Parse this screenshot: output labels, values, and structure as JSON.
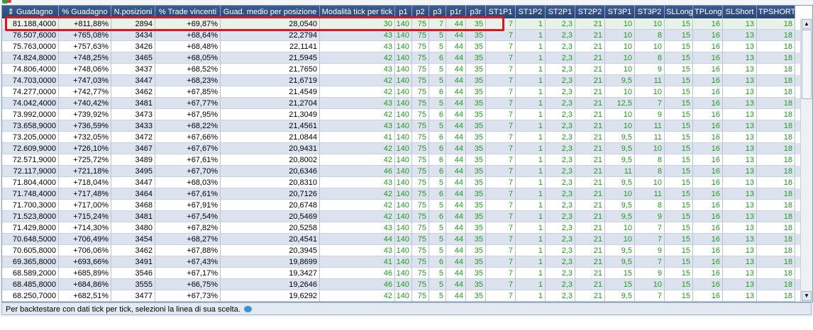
{
  "columns": [
    {
      "label": "Guadagno",
      "sort_icon": "sort-arrow-icon"
    },
    {
      "label": "% Guadagno"
    },
    {
      "label": "N.posizioni"
    },
    {
      "label": "% Trade vincenti"
    },
    {
      "label": "Guad. medio per posizione"
    },
    {
      "label": "Modalità tick per tick"
    },
    {
      "label": "p1"
    },
    {
      "label": "p2"
    },
    {
      "label": "p3"
    },
    {
      "label": "p1r"
    },
    {
      "label": "p3r"
    },
    {
      "label": "ST1P1"
    },
    {
      "label": "ST1P2"
    },
    {
      "label": "ST2P1"
    },
    {
      "label": "ST2P2"
    },
    {
      "label": "ST3P1"
    },
    {
      "label": "ST3P2"
    },
    {
      "label": "SLLong"
    },
    {
      "label": "TPLong"
    },
    {
      "label": "SLShort"
    },
    {
      "label": "TPSHORT"
    }
  ],
  "rows": [
    [
      "81.188,4000",
      "+811,88%",
      "2894",
      "+69,87%",
      "28,0540",
      "30",
      "140",
      "75",
      "7",
      "44",
      "35",
      "7",
      "1",
      "2,3",
      "21",
      "10",
      "10",
      "15",
      "16",
      "13",
      "18"
    ],
    [
      "76.507,6000",
      "+765,08%",
      "3434",
      "+68,64%",
      "22,2794",
      "43",
      "140",
      "75",
      "5",
      "44",
      "35",
      "7",
      "1",
      "2,3",
      "21",
      "10",
      "8",
      "15",
      "16",
      "13",
      "18"
    ],
    [
      "75.763,0000",
      "+757,63%",
      "3426",
      "+68,48%",
      "22,1141",
      "43",
      "140",
      "75",
      "5",
      "44",
      "35",
      "7",
      "1",
      "2,3",
      "21",
      "10",
      "10",
      "15",
      "16",
      "13",
      "18"
    ],
    [
      "74.824,8000",
      "+748,25%",
      "3465",
      "+68,05%",
      "21,5945",
      "42",
      "140",
      "75",
      "6",
      "44",
      "35",
      "7",
      "1",
      "2,3",
      "21",
      "10",
      "8",
      "15",
      "16",
      "13",
      "18"
    ],
    [
      "74.806,4000",
      "+748,06%",
      "3437",
      "+68,52%",
      "21,7650",
      "43",
      "140",
      "75",
      "5",
      "44",
      "35",
      "7",
      "1",
      "2,3",
      "21",
      "10",
      "9",
      "15",
      "16",
      "13",
      "18"
    ],
    [
      "74.703,0000",
      "+747,03%",
      "3447",
      "+68,23%",
      "21,6719",
      "42",
      "140",
      "75",
      "5",
      "44",
      "35",
      "7",
      "1",
      "2,3",
      "21",
      "9,5",
      "11",
      "15",
      "16",
      "13",
      "18"
    ],
    [
      "74.277,0000",
      "+742,77%",
      "3462",
      "+67,85%",
      "21,4549",
      "42",
      "140",
      "75",
      "6",
      "44",
      "35",
      "7",
      "1",
      "2,3",
      "21",
      "10",
      "10",
      "15",
      "16",
      "13",
      "18"
    ],
    [
      "74.042,4000",
      "+740,42%",
      "3481",
      "+67,77%",
      "21,2704",
      "43",
      "140",
      "75",
      "5",
      "44",
      "35",
      "7",
      "1",
      "2,3",
      "21",
      "12,5",
      "7",
      "15",
      "16",
      "13",
      "18"
    ],
    [
      "73.992,0000",
      "+739,92%",
      "3473",
      "+67,95%",
      "21,3049",
      "42",
      "140",
      "75",
      "6",
      "44",
      "35",
      "7",
      "1",
      "2,3",
      "21",
      "10",
      "9",
      "15",
      "16",
      "13",
      "18"
    ],
    [
      "73.658,9000",
      "+736,59%",
      "3433",
      "+68,22%",
      "21,4561",
      "43",
      "140",
      "75",
      "5",
      "44",
      "35",
      "7",
      "1",
      "2,3",
      "21",
      "10",
      "11",
      "15",
      "16",
      "13",
      "18"
    ],
    [
      "73.205,0000",
      "+732,05%",
      "3472",
      "+67,66%",
      "21,0844",
      "41",
      "140",
      "75",
      "6",
      "44",
      "35",
      "7",
      "1",
      "2,3",
      "21",
      "9,5",
      "11",
      "15",
      "16",
      "13",
      "18"
    ],
    [
      "72.609,9000",
      "+726,10%",
      "3467",
      "+67,67%",
      "20,9431",
      "42",
      "140",
      "75",
      "6",
      "44",
      "35",
      "7",
      "1",
      "2,3",
      "21",
      "9,5",
      "10",
      "15",
      "16",
      "13",
      "18"
    ],
    [
      "72.571,9000",
      "+725,72%",
      "3489",
      "+67,61%",
      "20,8002",
      "42",
      "140",
      "75",
      "6",
      "44",
      "35",
      "7",
      "1",
      "2,3",
      "21",
      "9,5",
      "8",
      "15",
      "16",
      "13",
      "18"
    ],
    [
      "72.117,9000",
      "+721,18%",
      "3495",
      "+67,70%",
      "20,6346",
      "46",
      "140",
      "75",
      "6",
      "44",
      "35",
      "7",
      "1",
      "2,3",
      "21",
      "11",
      "8",
      "15",
      "16",
      "13",
      "18"
    ],
    [
      "71.804,4000",
      "+718,04%",
      "3447",
      "+68,03%",
      "20,8310",
      "43",
      "140",
      "75",
      "5",
      "44",
      "35",
      "7",
      "1",
      "2,3",
      "21",
      "9,5",
      "10",
      "15",
      "16",
      "13",
      "18"
    ],
    [
      "71.748,4000",
      "+717,48%",
      "3464",
      "+67,61%",
      "20,7126",
      "42",
      "140",
      "75",
      "6",
      "44",
      "35",
      "7",
      "1",
      "2,3",
      "21",
      "10",
      "11",
      "15",
      "16",
      "13",
      "18"
    ],
    [
      "71.700,3000",
      "+717,00%",
      "3468",
      "+67,91%",
      "20,6748",
      "42",
      "140",
      "75",
      "5",
      "44",
      "35",
      "7",
      "1",
      "2,3",
      "21",
      "9,5",
      "8",
      "15",
      "16",
      "13",
      "18"
    ],
    [
      "71.523,8000",
      "+715,24%",
      "3481",
      "+67,54%",
      "20,5469",
      "42",
      "140",
      "75",
      "6",
      "44",
      "35",
      "7",
      "1",
      "2,3",
      "21",
      "9,5",
      "9",
      "15",
      "16",
      "13",
      "18"
    ],
    [
      "71.429,8000",
      "+714,30%",
      "3480",
      "+67,82%",
      "20,5258",
      "43",
      "140",
      "75",
      "5",
      "44",
      "35",
      "7",
      "1",
      "2,3",
      "21",
      "10",
      "7",
      "15",
      "16",
      "13",
      "18"
    ],
    [
      "70.648,5000",
      "+706,49%",
      "3454",
      "+68,27%",
      "20,4541",
      "44",
      "140",
      "75",
      "5",
      "44",
      "35",
      "7",
      "1",
      "2,3",
      "21",
      "10",
      "7",
      "15",
      "16",
      "13",
      "18"
    ],
    [
      "70.605,8000",
      "+706,06%",
      "3462",
      "+67,88%",
      "20,3945",
      "43",
      "140",
      "75",
      "5",
      "44",
      "35",
      "7",
      "1",
      "2,3",
      "21",
      "9,5",
      "9",
      "15",
      "16",
      "13",
      "18"
    ],
    [
      "69.365,8000",
      "+693,66%",
      "3491",
      "+67,43%",
      "19,8699",
      "41",
      "140",
      "75",
      "6",
      "44",
      "35",
      "7",
      "1",
      "2,3",
      "21",
      "9,5",
      "7",
      "15",
      "16",
      "13",
      "18"
    ],
    [
      "68.589,2000",
      "+685,89%",
      "3546",
      "+67,17%",
      "19,3427",
      "46",
      "140",
      "75",
      "5",
      "44",
      "35",
      "7",
      "1",
      "2,3",
      "21",
      "15",
      "9",
      "15",
      "16",
      "13",
      "18"
    ],
    [
      "68.485,8000",
      "+684,86%",
      "3555",
      "+66,75%",
      "19,2646",
      "46",
      "140",
      "75",
      "5",
      "44",
      "35",
      "7",
      "1",
      "2,3",
      "21",
      "15",
      "10",
      "15",
      "16",
      "13",
      "18"
    ],
    [
      "68.250,7000",
      "+682,51%",
      "3477",
      "+67,73%",
      "19,6292",
      "42",
      "140",
      "75",
      "5",
      "44",
      "35",
      "7",
      "1",
      "2,3",
      "21",
      "9,5",
      "7",
      "15",
      "16",
      "13",
      "18"
    ]
  ],
  "selected_row": 0,
  "status": {
    "text": "Per backtestare con dati tick per tick, selezioni la linea di sua scelta.",
    "icon": "chat-bubble-icon"
  },
  "colors": {
    "header_bg": "#2a4677",
    "param_text": "#1f9a1f",
    "highlight": "#e0141e",
    "alt_row": "#dce3ee"
  }
}
